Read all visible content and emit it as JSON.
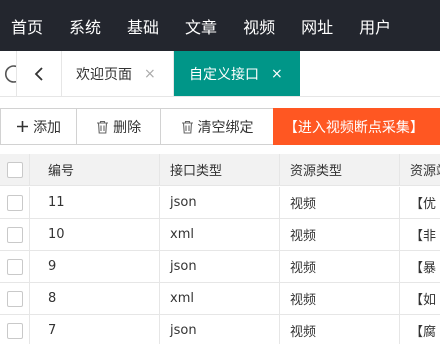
{
  "nav": [
    "首页",
    "系统",
    "基础",
    "文章",
    "视频",
    "网址",
    "用户"
  ],
  "tabs": {
    "welcome": "欢迎页面",
    "active": "自定义接口",
    "close_glyph": "×"
  },
  "toolbar": {
    "add": "添加",
    "delete": "删除",
    "clear": "清空绑定",
    "collect": "【进入视频断点采集】"
  },
  "table": {
    "headers": [
      "编号",
      "接口类型",
      "资源类型",
      "资源站"
    ],
    "rows": [
      {
        "id": "11",
        "type": "json",
        "res": "视频",
        "site": "【优"
      },
      {
        "id": "10",
        "type": "xml",
        "res": "视频",
        "site": "【非"
      },
      {
        "id": "9",
        "type": "json",
        "res": "视频",
        "site": "【暴"
      },
      {
        "id": "8",
        "type": "xml",
        "res": "视频",
        "site": "【如"
      },
      {
        "id": "7",
        "type": "json",
        "res": "视频",
        "site": "【腐"
      }
    ]
  },
  "colors": {
    "topbar": "#23262e",
    "tab_active": "#009688",
    "collect_button": "#ff5722",
    "table_header": "#f2f2f2"
  }
}
